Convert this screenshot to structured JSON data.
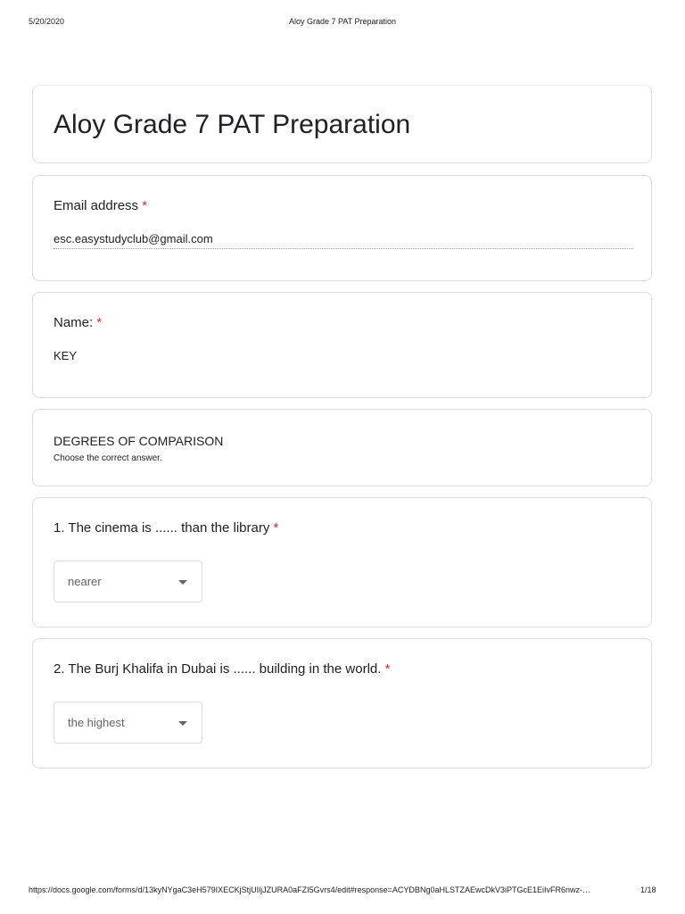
{
  "print_header": {
    "date": "5/20/2020",
    "title": "Aloy Grade 7 PAT Preparation"
  },
  "form": {
    "title": "Aloy Grade 7 PAT Preparation"
  },
  "email_question": {
    "label": "Email address",
    "required_mark": "*",
    "value": "esc.easystudyclub@gmail.com"
  },
  "name_question": {
    "label": "Name:",
    "required_mark": "*",
    "value": "KEY"
  },
  "section": {
    "title": "DEGREES OF COMPARISON",
    "description": "Choose the correct answer."
  },
  "questions": [
    {
      "text": "1. The cinema is ...... than the library",
      "required_mark": "*",
      "selected": "nearer"
    },
    {
      "text": "2. The Burj Khalifa in Dubai is ...... building in the world.",
      "required_mark": "*",
      "selected": "the highest"
    }
  ],
  "print_footer": {
    "url": "https://docs.google.com/forms/d/13kyNYgaC3eH579IXECKjStjUIljJZURA0aFZI5Gvrs4/edit#response=ACYDBNg0aHLSTZAEwcDkV3iPTGcE1EiIvFR6nwz-…",
    "page": "1/18"
  },
  "colors": {
    "required": "#d93025",
    "border": "#dadce0",
    "text": "#202124",
    "muted": "#5f6368"
  }
}
